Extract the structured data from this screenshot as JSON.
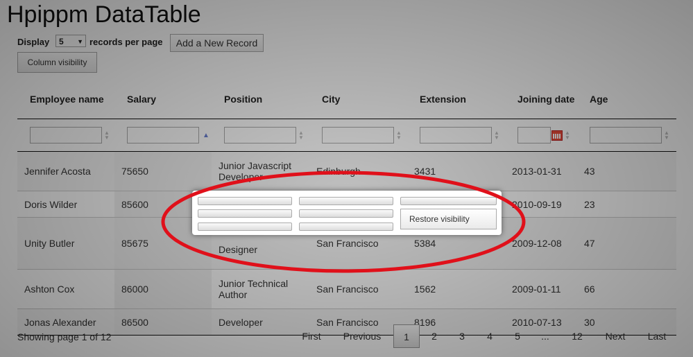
{
  "page": {
    "title": "Hpippm DataTable"
  },
  "toolbar": {
    "display_label": "Display",
    "per_page_value": "5",
    "per_page_suffix": "records per page",
    "add_button": "Add a New Record",
    "column_visibility_button": "Column visibility"
  },
  "table": {
    "headers": [
      "Employee name",
      "Salary",
      "Position",
      "City",
      "Extension",
      "Joining date",
      "Age"
    ],
    "rows": [
      {
        "name": "Jennifer Acosta",
        "salary": "75650",
        "position": "Junior Javascript Developer",
        "city": "Edinburgh",
        "extension": "3431",
        "date": "2013-01-31",
        "age": "43"
      },
      {
        "name": "Doris Wilder",
        "salary": "85600",
        "position": "",
        "city": "",
        "extension": "",
        "date": "2010-09-19",
        "age": "23"
      },
      {
        "name": "Unity Butler",
        "salary": "85675",
        "position": "Designer",
        "city": "San Francisco",
        "extension": "5384",
        "date": "2009-12-08",
        "age": "47"
      },
      {
        "name": "Ashton Cox",
        "salary": "86000",
        "position": "Junior Technical Author",
        "city": "San Francisco",
        "extension": "1562",
        "date": "2009-01-11",
        "age": "66"
      },
      {
        "name": "Jonas Alexander",
        "salary": "86500",
        "position": "Developer",
        "city": "San Francisco",
        "extension": "8196",
        "date": "2010-07-13",
        "age": "30"
      }
    ]
  },
  "footer": {
    "info": "Showing page 1 of 12"
  },
  "pagination": {
    "first": "First",
    "previous": "Previous",
    "pages": [
      "1",
      "2",
      "3",
      "4",
      "5",
      "...",
      "12"
    ],
    "next": "Next",
    "last": "Last"
  },
  "popup": {
    "restore_label": "Restore visibility"
  },
  "colors": {
    "annotation": "#e0101a",
    "sort_active": "#6a7fd0",
    "calendar": "#e84a3a"
  },
  "icons": {
    "sort": "sort-both-icon",
    "sort_active": "sort-asc-icon",
    "calendar": "calendar-icon"
  }
}
